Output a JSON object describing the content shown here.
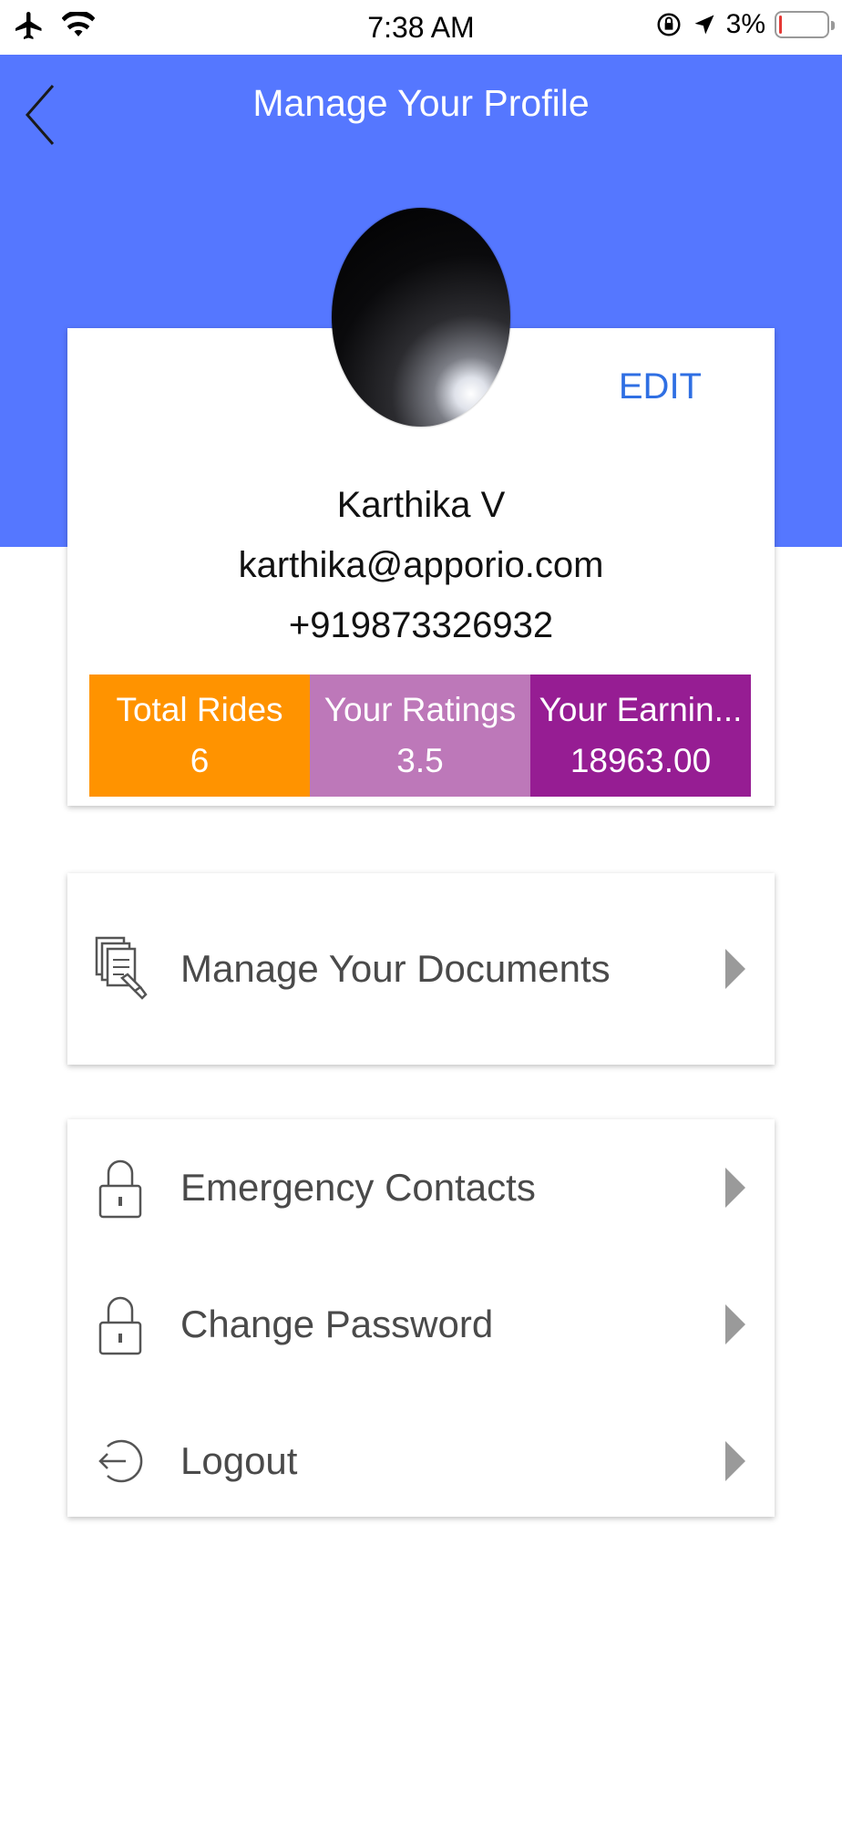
{
  "status_bar": {
    "time": "7:38 AM",
    "battery_percent": "3%",
    "icons": [
      "airplane-icon",
      "wifi-icon",
      "rotation-lock-icon",
      "location-arrow-icon",
      "battery-icon"
    ]
  },
  "header": {
    "title": "Manage Your Profile",
    "background_color": "#5577ff",
    "back_icon": "chevron-left-icon"
  },
  "profile": {
    "edit_label": "EDIT",
    "name": "Karthika V",
    "email": "karthika@apporio.com",
    "phone": "+919873326932",
    "stats": [
      {
        "label": "Total Rides",
        "value": "6",
        "color": "#ff9300"
      },
      {
        "label": "Your Ratings",
        "value": "3.5",
        "color": "#bd78b9"
      },
      {
        "label": "Your Earnin...",
        "value": "18963.00",
        "color": "#961d93"
      }
    ]
  },
  "menu": {
    "documents": {
      "label": "Manage Your Documents",
      "icon": "documents-icon"
    },
    "emergency": {
      "label": "Emergency Contacts",
      "icon": "lock-icon"
    },
    "password": {
      "label": "Change Password",
      "icon": "lock-icon"
    },
    "logout": {
      "label": "Logout",
      "icon": "logout-icon"
    }
  }
}
